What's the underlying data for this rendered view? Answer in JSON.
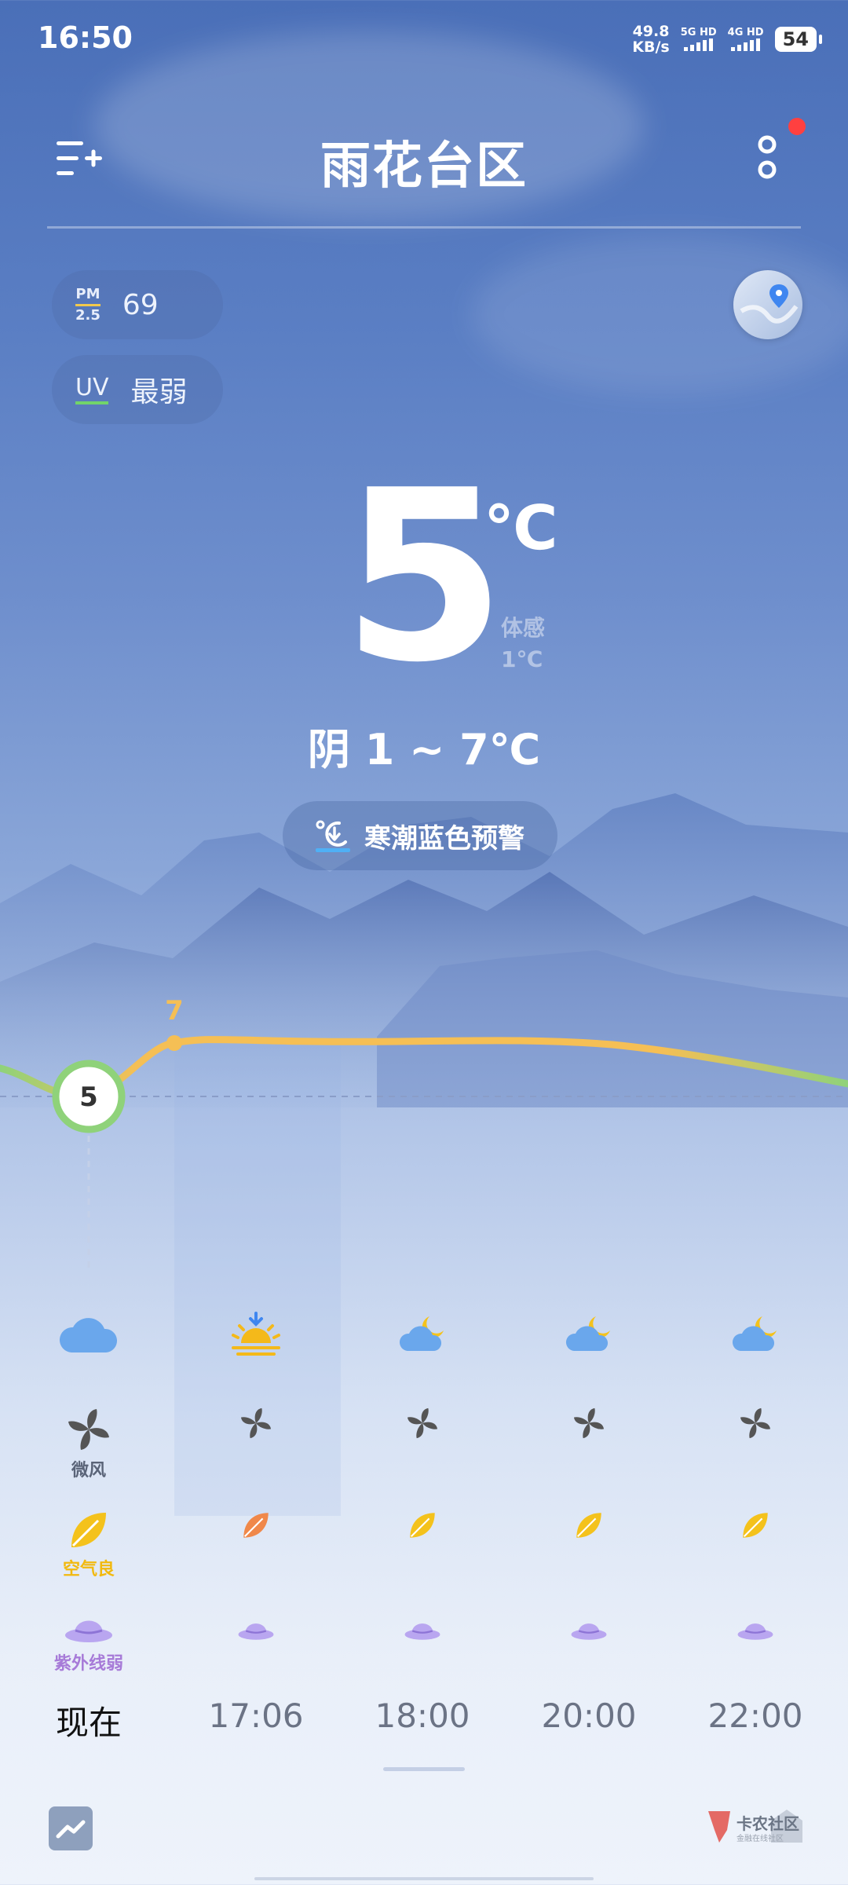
{
  "status_bar": {
    "time": "16:50",
    "net_speed_value": "49.8",
    "net_speed_unit": "KB/s",
    "sim1": "5G HD",
    "sim2": "4G HD",
    "battery": "54"
  },
  "header": {
    "title": "雨花台区",
    "menu_icon": "add-city-menu-icon",
    "more_icon": "more-vertical-icon",
    "notification_dot_color": "#ff4040"
  },
  "indicators": {
    "pm_label_top": "PM",
    "pm_label_bottom": "2.5",
    "pm_value": "69",
    "uv_label": "UV",
    "uv_value": "最弱",
    "map_icon": "map-pin-icon"
  },
  "current": {
    "temperature": "5",
    "unit": "℃",
    "feels_label": "体感",
    "feels_value": "1℃",
    "condition_range": "阴   1 ~ 7℃"
  },
  "alert": {
    "icon": "cold-wave-icon",
    "text": "寒潮蓝色预警"
  },
  "chart_data": {
    "type": "line",
    "current_label": "5",
    "max_label": "7",
    "current_value": 5,
    "max_value": 7,
    "colors": {
      "cool": "#8fd27a",
      "warm": "#f5bf55"
    }
  },
  "hourly": [
    {
      "time": "现在",
      "weather_icon": "cloudy-icon",
      "wind_icon": "fan-icon",
      "wind_label": "微风",
      "air_icon": "leaf-icon",
      "air_label": "空气良",
      "uv_icon": "hat-icon",
      "uv_label": "紫外线弱",
      "leaf_color": "#f4c21c"
    },
    {
      "time": "17:06",
      "weather_icon": "sunset-icon",
      "wind_icon": "fan-icon",
      "air_icon": "leaf-icon",
      "uv_icon": "hat-icon",
      "leaf_color": "#f0884a"
    },
    {
      "time": "18:00",
      "weather_icon": "cloudy-night-icon",
      "wind_icon": "fan-icon",
      "air_icon": "leaf-icon",
      "uv_icon": "hat-icon",
      "leaf_color": "#f4c21c"
    },
    {
      "time": "20:00",
      "weather_icon": "cloudy-night-icon",
      "wind_icon": "fan-icon",
      "air_icon": "leaf-icon",
      "uv_icon": "hat-icon",
      "leaf_color": "#f4c21c"
    },
    {
      "time": "22:00",
      "weather_icon": "cloudy-night-icon",
      "wind_icon": "fan-icon",
      "air_icon": "leaf-icon",
      "uv_icon": "hat-icon",
      "leaf_color": "#f4c21c"
    }
  ],
  "footer": {
    "trend_icon": "trend-chart-icon",
    "watermark_icon": "community-logo",
    "watermark_text": "卡农社区",
    "watermark_sub": "金融在线社区"
  }
}
